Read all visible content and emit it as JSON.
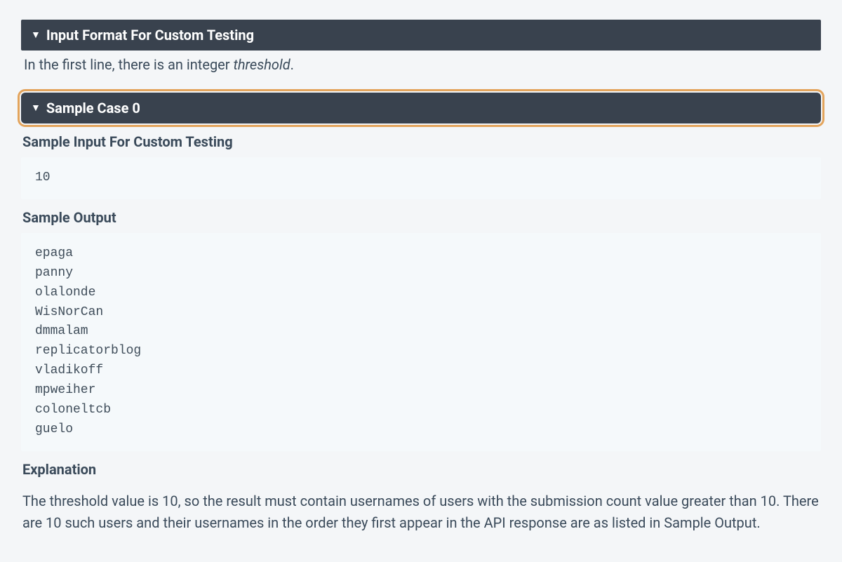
{
  "sections": {
    "input_format": {
      "title": "Input Format For Custom Testing",
      "body_prefix": "In the first line, there is an integer ",
      "body_italic": "threshold",
      "body_suffix": "."
    },
    "sample0": {
      "title": "Sample Case 0",
      "input_heading": "Sample Input For Custom Testing",
      "input_code": "10",
      "output_heading": "Sample Output",
      "output_lines": [
        "epaga",
        "panny",
        "olalonde",
        "WisNorCan",
        "dmmalam",
        "replicatorblog",
        "vladikoff",
        "mpweiher",
        "coloneltcb",
        "guelo"
      ],
      "explanation_heading": "Explanation",
      "explanation_text": "The threshold value is 10, so the result must contain usernames of users with the submission count value greater than 10. There are 10 such users and their usernames in the order they first appear in the API response are as listed in Sample Output."
    }
  }
}
